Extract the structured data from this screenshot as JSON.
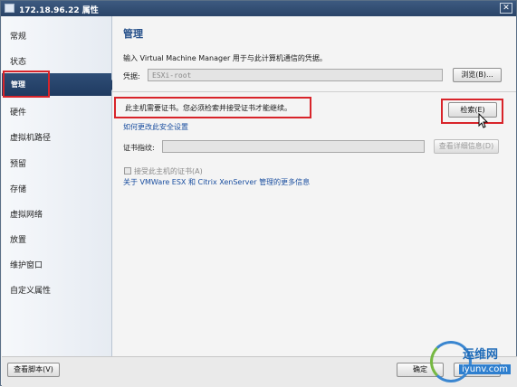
{
  "window": {
    "title": "172.18.96.22 属性",
    "close_glyph": "✕"
  },
  "sidebar": {
    "items": [
      {
        "label": "常规"
      },
      {
        "label": "状态"
      },
      {
        "label": "管理"
      },
      {
        "label": "硬件"
      },
      {
        "label": "虚拟机路径"
      },
      {
        "label": "预留"
      },
      {
        "label": "存储"
      },
      {
        "label": "虚拟网络"
      },
      {
        "label": "放置"
      },
      {
        "label": "维护窗口"
      },
      {
        "label": "自定义属性"
      }
    ],
    "active_index": 2
  },
  "main": {
    "heading": "管理",
    "description": "输入 Virtual Machine Manager 用于与此计算机通信的凭据。",
    "credential_label": "凭据:",
    "credential_value": "ESXi-root",
    "browse_button": "浏览(B)...",
    "cert_notice": "此主机需要证书。您必须检索并接受证书才能继续。",
    "retrieve_button": "检索(E)",
    "security_link": "如何更改此安全设置",
    "thumbprint_label": "证书指纹:",
    "thumbprint_value": "",
    "view_details_button": "查看详细信息(D)",
    "accept_checkbox_label": "接受此主机的证书(A)",
    "more_info_link": "关于 VMWare ESX 和 Citrix XenServer 管理的更多信息"
  },
  "footer": {
    "view_script_button": "查看脚本(V)",
    "ok_button": "确定",
    "cancel_button": "取消"
  },
  "watermark": {
    "cn_text": "运维网",
    "en_text": "iyunv.com"
  },
  "colors": {
    "title_bar": "#2f4c74",
    "nav_active": "#1f3a60",
    "highlight_box": "#d8242a",
    "heading": "#26508a",
    "link": "#1b4fa0"
  }
}
